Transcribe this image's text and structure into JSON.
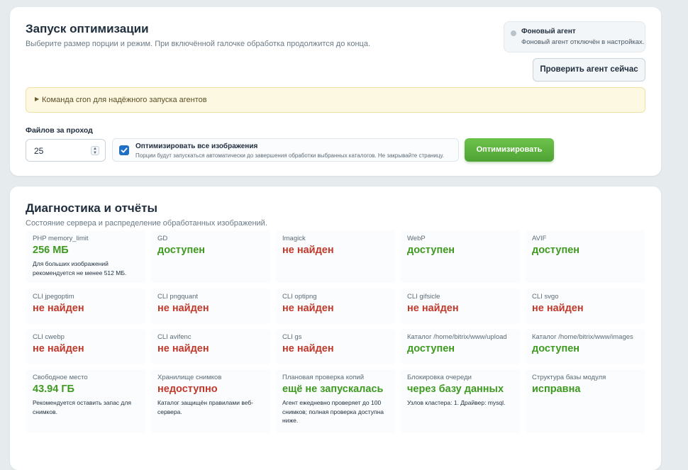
{
  "optimization": {
    "title": "Запуск оптимизации",
    "subtitle": "Выберите размер порции и режим. При включённой галочке обработка продолжится до конца.",
    "agent": {
      "title": "Фоновый агент",
      "text": "Фоновый агент отключён в настройках.",
      "check_button": "Проверить агент сейчас"
    },
    "cron_hint": "Команда cron для надёжного запуска агентов",
    "files_label": "Файлов за проход",
    "files_value": "25",
    "optimize_all": {
      "checked": true,
      "title": "Оптимизировать все изображения",
      "text": "Порции будут запускаться автоматически до завершения обработки выбранных каталогов. Не закрывайте страницу."
    },
    "optimize_button": "Оптимизировать"
  },
  "diagnostics": {
    "title": "Диагностика и отчёты",
    "subtitle": "Состояние сервера и распределение обработанных изображений.",
    "rows": [
      [
        {
          "label": "PHP memory_limit",
          "value": "256 МБ",
          "status": "ok",
          "note": "Для больших изображений рекомендуется не менее 512 МБ."
        },
        {
          "label": "GD",
          "value": "доступен",
          "status": "ok",
          "note": ""
        },
        {
          "label": "Imagick",
          "value": "не найден",
          "status": "bad",
          "note": ""
        },
        {
          "label": "WebP",
          "value": "доступен",
          "status": "ok",
          "note": ""
        },
        {
          "label": "AVIF",
          "value": "доступен",
          "status": "ok",
          "note": ""
        }
      ],
      [
        {
          "label": "CLI jpegoptim",
          "value": "не найден",
          "status": "bad",
          "note": ""
        },
        {
          "label": "CLI pngquant",
          "value": "не найден",
          "status": "bad",
          "note": ""
        },
        {
          "label": "CLI optipng",
          "value": "не найден",
          "status": "bad",
          "note": ""
        },
        {
          "label": "CLI gifsicle",
          "value": "не найден",
          "status": "bad",
          "note": ""
        },
        {
          "label": "CLI svgo",
          "value": "не найден",
          "status": "bad",
          "note": ""
        }
      ],
      [
        {
          "label": "CLI cwebp",
          "value": "не найден",
          "status": "bad",
          "note": ""
        },
        {
          "label": "CLI avifenc",
          "value": "не найден",
          "status": "bad",
          "note": ""
        },
        {
          "label": "CLI gs",
          "value": "не найден",
          "status": "bad",
          "note": ""
        },
        {
          "label": "Каталог /home/bitrix/www/upload",
          "value": "доступен",
          "status": "ok",
          "note": ""
        },
        {
          "label": "Каталог /home/bitrix/www/images",
          "value": "доступен",
          "status": "ok",
          "note": ""
        }
      ],
      [
        {
          "label": "Свободное место",
          "value": "43.94 ГБ",
          "status": "ok",
          "note": "Рекомендуется оставить запас для снимков."
        },
        {
          "label": "Хранилище снимков",
          "value": "недоступно",
          "status": "bad",
          "note": "Каталог защищён правилами веб-сервера."
        },
        {
          "label": "Плановая проверка копий",
          "value": "ещё не запускалась",
          "status": "ok",
          "note": "Агент ежедневно проверяет до 100 снимков; полная проверка доступна ниже."
        },
        {
          "label": "Блокировка очереди",
          "value": "через базу данных",
          "status": "ok",
          "note": "Узлов кластера: 1. Драйвер: mysql."
        },
        {
          "label": "Структура базы модуля",
          "value": "исправна",
          "status": "ok",
          "note": ""
        }
      ]
    ]
  }
}
